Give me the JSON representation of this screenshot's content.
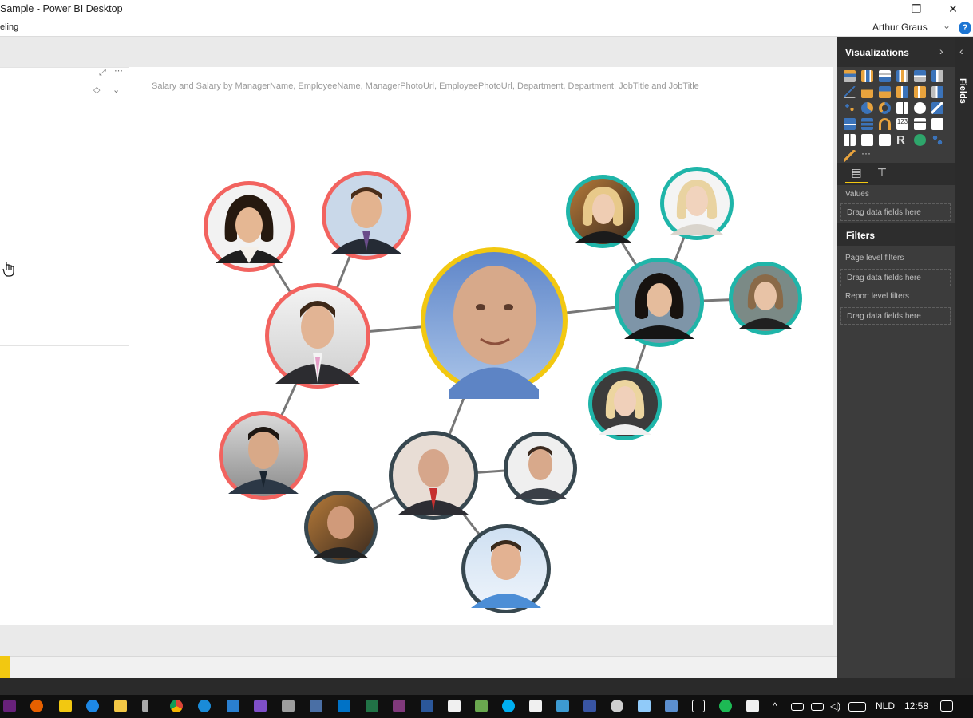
{
  "window": {
    "title": "Sample - Power BI Desktop",
    "minimize": "—",
    "maximize": "❐",
    "close": "✕"
  },
  "menubar": {
    "partial_label": "eling",
    "user": "Arthur Graus",
    "help": "?"
  },
  "visual": {
    "title": "Salary and Salary by ManagerName, EmployeeName, ManagerPhotoUrl, EmployeePhotoUrl, Department, Department, JobTitle and JobTitle"
  },
  "network": {
    "colors": {
      "center": "#f2c811",
      "coral": "#f2635f",
      "teal": "#1fb5a9",
      "dark": "#37474f",
      "edge": "#777777"
    }
  },
  "visualizations_pane": {
    "title": "Visualizations",
    "more": "···",
    "values_label": "Values",
    "values_drop": "Drag data fields here"
  },
  "filters_pane": {
    "title": "Filters",
    "page_level": "Page level filters",
    "page_drop": "Drag data fields here",
    "report_level": "Report level filters",
    "report_drop": "Drag data fields here"
  },
  "fields_pane": {
    "label": "Fields"
  },
  "taskbar": {
    "language": "NLD",
    "time": "12:58"
  }
}
